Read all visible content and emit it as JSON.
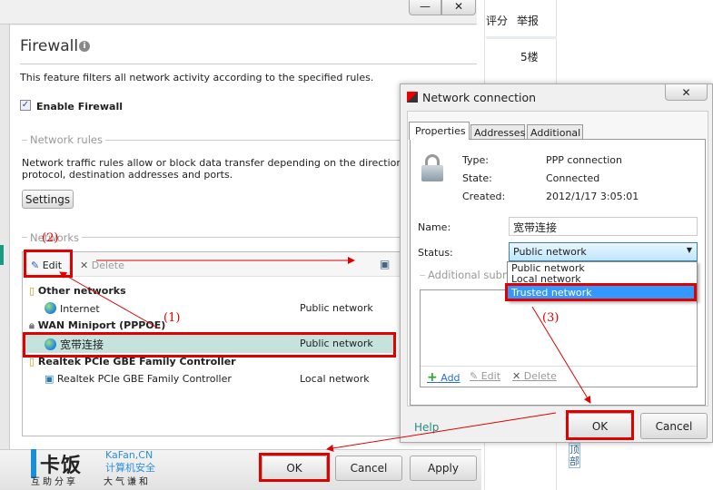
{
  "forum": {
    "rate": "评分",
    "report": "举报",
    "floor": "5楼",
    "top": "顶部"
  },
  "main": {
    "title": "Firewall",
    "description": "This feature filters all network activity according to the specified rules.",
    "enable_label": "Enable Firewall",
    "enable_checked": true,
    "rules_section": "Network rules",
    "rules_text_1": "Network traffic rules allow or block data transfer depending on the direction, tra",
    "rules_text_2": "protocol, destination addresses and ports.",
    "settings_label": "Settings",
    "networks_section": "Networks",
    "toolbar": {
      "edit": "Edit",
      "delete": "Delete"
    },
    "networks": [
      {
        "type": "group",
        "name": "Other networks"
      },
      {
        "type": "item",
        "name": "Internet",
        "status": "Public network"
      },
      {
        "type": "group",
        "name": "WAN Miniport (PPPOE)"
      },
      {
        "type": "item",
        "name": "宽带连接",
        "status": "Public network",
        "selected": true
      },
      {
        "type": "group",
        "name": "Realtek PCIe GBE Family Controller"
      },
      {
        "type": "item",
        "name": "Realtek PCIe GBE Family Controller",
        "status": "Local network"
      }
    ],
    "ok": "OK",
    "cancel": "Cancel",
    "apply": "Apply"
  },
  "logo": {
    "brand": "卡饭",
    "site": "KaFan,CN",
    "tagline": "计算机安全",
    "motto_1": "互助分享",
    "motto_2": "大气谦和"
  },
  "dialog": {
    "title": "Network connection",
    "tabs": [
      "Properties",
      "Addresses",
      "Additional"
    ],
    "type_label": "Type:",
    "type_value": "PPP connection",
    "state_label": "State:",
    "state_value": "Connected",
    "created_label": "Created:",
    "created_value": "2012/1/17 3:05:01",
    "name_label": "Name:",
    "name_value": "宽带连接",
    "status_label": "Status:",
    "status_value": "Public network",
    "status_options": [
      "Public network",
      "Local network",
      "Trusted network"
    ],
    "subnets_section": "Additional subne",
    "add": "Add",
    "edit": "Edit",
    "delete": "Delete",
    "help": "Help",
    "ok": "OK",
    "cancel": "Cancel"
  },
  "annotations": {
    "step1": "(1)",
    "step2": "(2)",
    "step3": "(3)"
  },
  "colors": {
    "annotation": "#e00000",
    "selection": "#3399ff",
    "row_highlight": "#c5e3dc"
  }
}
